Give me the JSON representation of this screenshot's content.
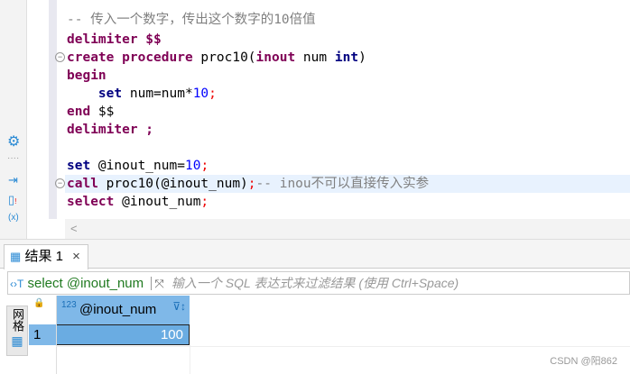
{
  "editor": {
    "line1": "-- 传入一个数字，传出这个数字的10倍值",
    "line2_kw": "delimiter",
    "line2_rest": " $$",
    "line3_kw1": "create",
    "line3_kw2": "procedure",
    "line3_name": " proc10(",
    "line3_kw3": "inout",
    "line3_mid": " num ",
    "line3_kw4": "int",
    "line3_end": ")",
    "line4": "begin",
    "line5_kw": "set",
    "line5_a": " num=num*",
    "line5_num": "10",
    "line5_semi": ";",
    "line6_kw": "end",
    "line6_rest": " $$",
    "line7_kw": "delimiter",
    "line7_rest": " ;",
    "line9_kw": "set",
    "line9_a": " @inout_num=",
    "line9_num": "10",
    "line9_semi": ";",
    "line10_kw": "call",
    "line10_a": " proc10(@inout_num)",
    "line10_semi": ";",
    "line10_cm": "-- inou不可以直接传入实参",
    "line11_kw": "select",
    "line11_a": " @inout_num",
    "line11_semi": ";"
  },
  "scroll_left": "<",
  "results": {
    "tab_label": "结果 1",
    "tab_close": "×",
    "filter_query": "select @inout_num",
    "filter_placeholder": "输入一个 SQL 表达式来过滤结果 (使用 Ctrl+Space)",
    "vertical_tab": "网格",
    "column_type": "123",
    "column_header": "@inout_num",
    "rows": [
      {
        "index": "1",
        "value": "100"
      }
    ]
  },
  "watermark": "CSDN @阳862",
  "colors": {
    "accent": "#2a8ad4",
    "header": "#7fb8e8",
    "selected": "#6aace2"
  }
}
